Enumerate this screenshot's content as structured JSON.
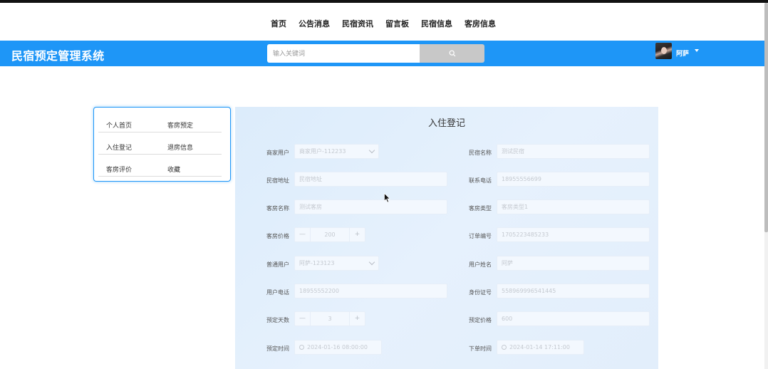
{
  "nav": [
    "首页",
    "公告消息",
    "民宿资讯",
    "留言板",
    "民宿信息",
    "客房信息"
  ],
  "brand": "民宿预定管理系统",
  "search": {
    "placeholder": "输入关键词"
  },
  "user": {
    "name": "阿萨"
  },
  "sidemenu": [
    [
      "个人首页",
      "客房预定"
    ],
    [
      "入住登记",
      "退房信息"
    ],
    [
      "客房评价",
      "收藏"
    ]
  ],
  "form": {
    "title": "入住登记",
    "fields": {
      "merchant_user": {
        "label": "商家用户",
        "value": "商家用户-112233"
      },
      "homestay_name": {
        "label": "民宿名称",
        "value": "测试民宿"
      },
      "homestay_address": {
        "label": "民宿地址",
        "value": "民宿地址"
      },
      "contact_phone": {
        "label": "联系电话",
        "value": "18955556699"
      },
      "room_name": {
        "label": "客房名称",
        "value": "测试客房"
      },
      "room_type": {
        "label": "客房类型",
        "value": "客房类型1"
      },
      "room_price": {
        "label": "客房价格",
        "value": "200"
      },
      "order_number": {
        "label": "订单编号",
        "value": "1705223485233"
      },
      "regular_user": {
        "label": "普通用户",
        "value": "阿萨-123123"
      },
      "user_name": {
        "label": "用户姓名",
        "value": "阿萨"
      },
      "user_phone": {
        "label": "用户电话",
        "value": "18955552200"
      },
      "id_number": {
        "label": "身份证号",
        "value": "558969996541445"
      },
      "booking_days": {
        "label": "预定天数",
        "value": "3"
      },
      "booking_price": {
        "label": "预定价格",
        "value": "600"
      },
      "booking_time": {
        "label": "预定时间",
        "value": "2024-01-16 08:00:00"
      },
      "order_time": {
        "label": "下单时间",
        "value": "2024-01-14 17:11:00"
      }
    },
    "stepper_minus": "—",
    "stepper_plus": "+"
  },
  "colors": {
    "header": "#1e96f7",
    "panel": "#e2eefb",
    "search_button": "#c8c8c8"
  }
}
